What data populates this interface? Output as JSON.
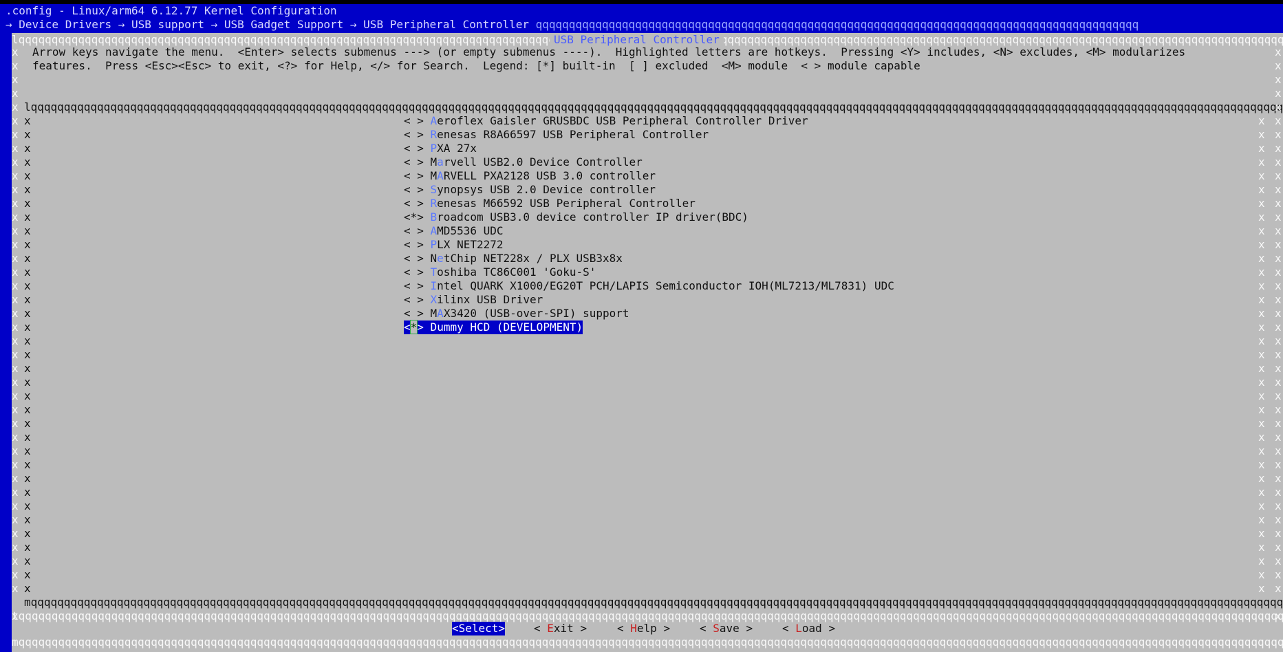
{
  "window": {
    "title": ".config - Linux/arm64 6.12.77 Kernel Configuration",
    "breadcrumb": "→ Device Drivers → USB support → USB Gadget Support → USB Peripheral Controller"
  },
  "dialog": {
    "title": "USB Peripheral Controller",
    "help_lines": [
      "Arrow keys navigate the menu.  <Enter> selects submenus ---> (or empty submenus ----).  Highlighted letters are hotkeys.  Pressing <Y> includes, <N> excludes, <M> modularizes",
      "features.  Press <Esc><Esc> to exit, <?> for Help, </> for Search.  Legend: [*] built-in  [ ] excluded  <M> module  < > module capable"
    ]
  },
  "menu": {
    "items": [
      {
        "state": "< >",
        "hotkey": "A",
        "rest": "eroflex Gaisler GRUSBDC USB Peripheral Controller Driver"
      },
      {
        "state": "< >",
        "hotkey": "R",
        "rest": "enesas R8A66597 USB Peripheral Controller"
      },
      {
        "state": "< >",
        "hotkey": "P",
        "rest": "XA 27x"
      },
      {
        "state": "< >",
        "pre": "M",
        "hotkey": "a",
        "rest": "rvell USB2.0 Device Controller"
      },
      {
        "state": "< >",
        "pre": "M",
        "hotkey": "A",
        "rest": "RVELL PXA2128 USB 3.0 controller"
      },
      {
        "state": "< >",
        "hotkey": "S",
        "rest": "ynopsys USB 2.0 Device controller"
      },
      {
        "state": "< >",
        "hotkey": "R",
        "rest": "enesas M66592 USB Peripheral Controller"
      },
      {
        "state": "<*>",
        "hotkey": "B",
        "rest": "roadcom USB3.0 device controller IP driver(BDC)"
      },
      {
        "state": "< >",
        "hotkey": "A",
        "rest": "MD5536 UDC"
      },
      {
        "state": "< >",
        "hotkey": "P",
        "rest": "LX NET2272"
      },
      {
        "state": "< >",
        "pre": "N",
        "hotkey": "e",
        "rest": "tChip NET228x / PLX USB3x8x"
      },
      {
        "state": "< >",
        "hotkey": "T",
        "rest": "oshiba TC86C001 'Goku-S'"
      },
      {
        "state": "< >",
        "hotkey": "I",
        "rest": "ntel QUARK X1000/EG20T PCH/LAPIS Semiconductor IOH(ML7213/ML7831) UDC"
      },
      {
        "state": "< >",
        "hotkey": "X",
        "rest": "ilinx USB Driver"
      },
      {
        "state": "< >",
        "pre": "M",
        "hotkey": "A",
        "rest": "X3420 (USB-over-SPI) support"
      }
    ],
    "selected": {
      "open": "<",
      "mark": "*",
      "close": ">",
      "label": " Dummy HCD (DEVELOPMENT)"
    }
  },
  "buttons": [
    {
      "open": "<",
      "hotkey": "",
      "rest": "Select",
      "close": ">",
      "active": true
    },
    {
      "open": "< ",
      "hotkey": "E",
      "rest": "xit",
      "close": " >",
      "active": false
    },
    {
      "open": "< ",
      "hotkey": "H",
      "rest": "elp",
      "close": " >",
      "active": false
    },
    {
      "open": "< ",
      "hotkey": "S",
      "rest": "ave",
      "close": " >",
      "active": false
    },
    {
      "open": "< ",
      "hotkey": "L",
      "rest": "oad",
      "close": " >",
      "active": false
    }
  ],
  "colors": {
    "background": "#0000c8",
    "dialog": "#bcbcbc",
    "hotkey": "#5a78ff",
    "button_hotkey": "#c82020"
  }
}
